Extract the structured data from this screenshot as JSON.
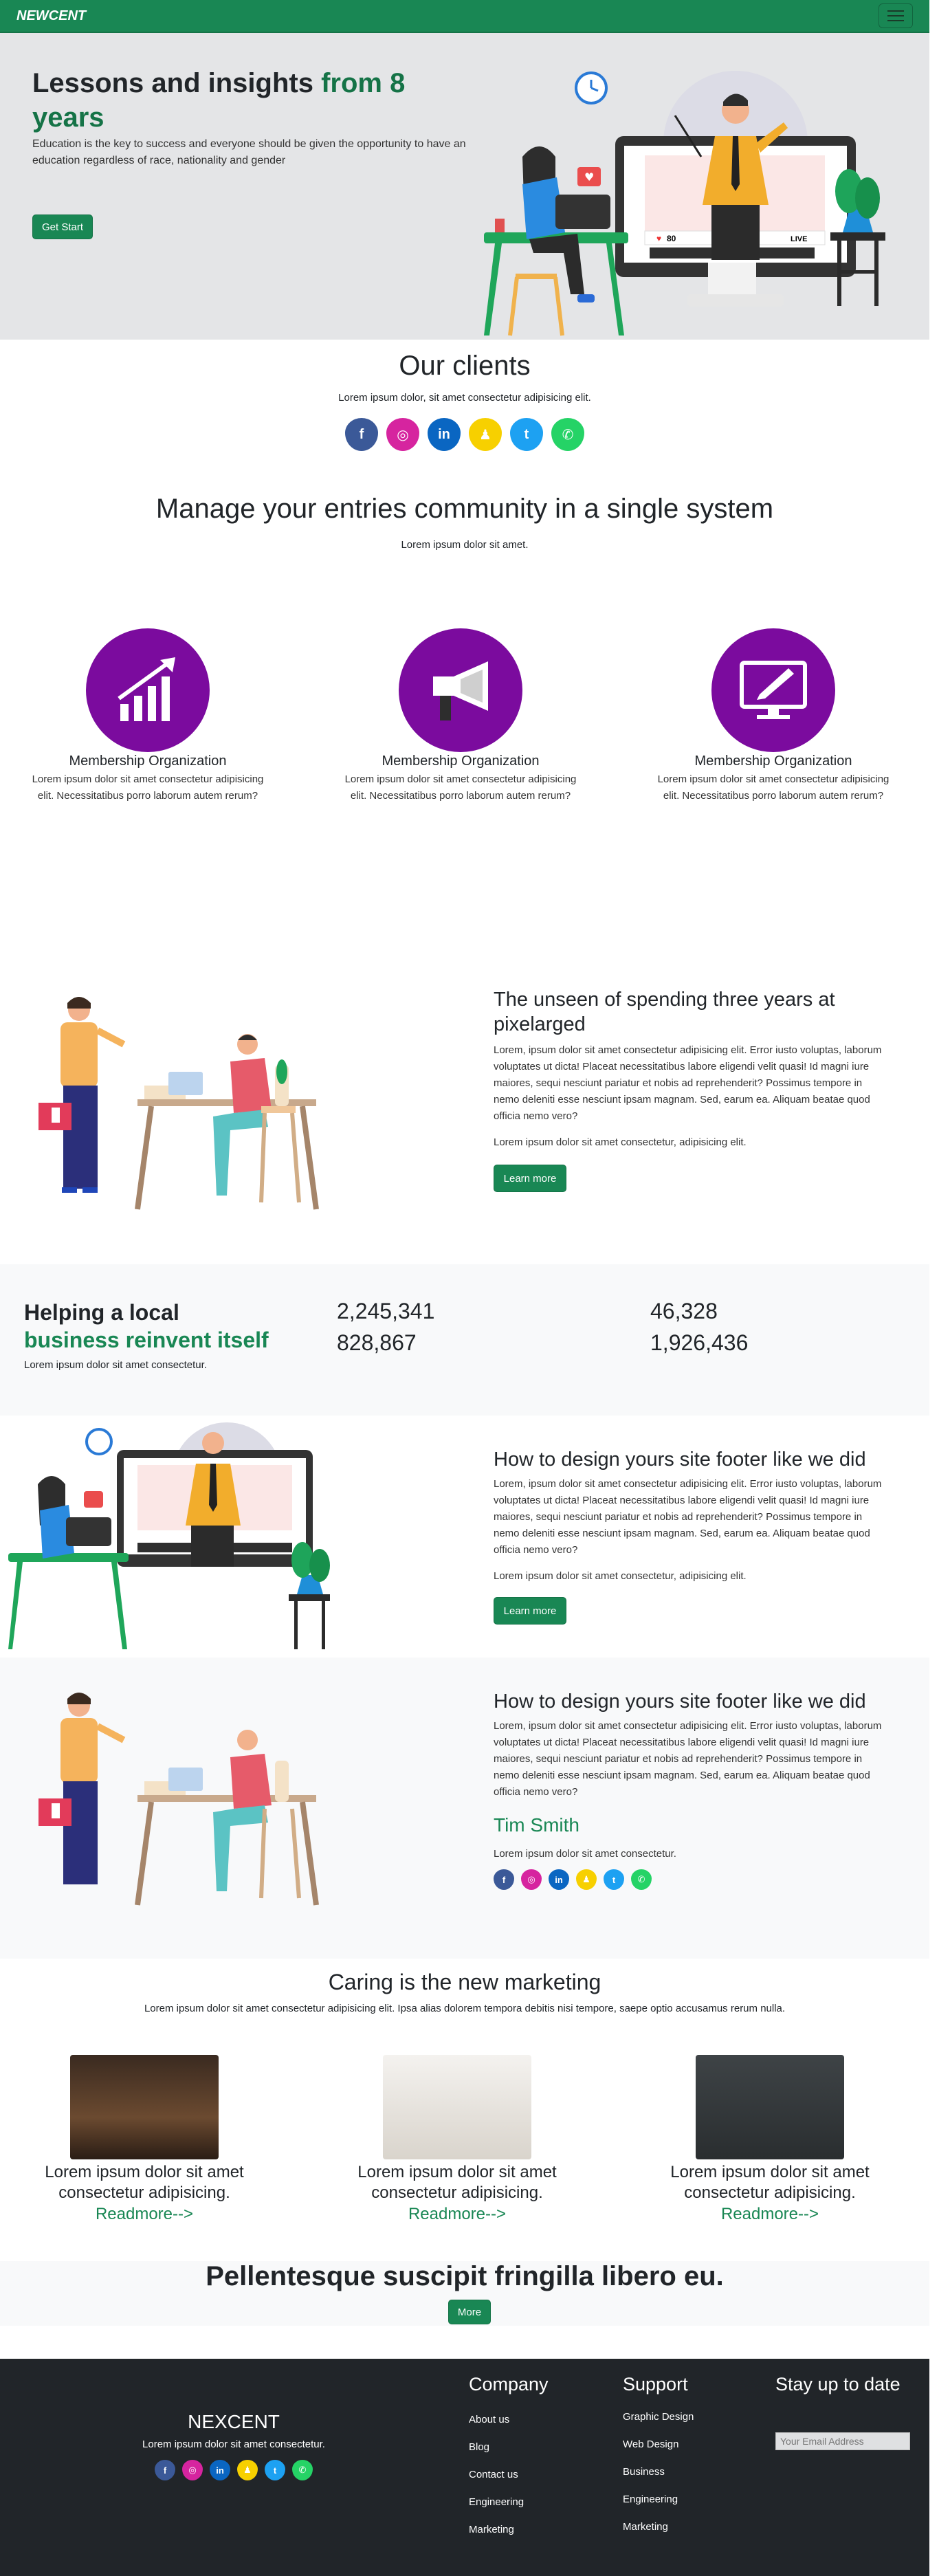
{
  "nav": {
    "brand": "NEWCENT"
  },
  "hero": {
    "title_black": "Lessons and insights ",
    "title_green": "from 8 years",
    "text": "Education is the key to success and everyone should be given the opportunity to have an education regardless of race, nationality and gender",
    "button": "Get Start",
    "screen_likes": "80",
    "screen_live": "LIVE"
  },
  "clients": {
    "title": "Our clients",
    "text": "Lorem ipsum dolor, sit amet consectetur adipisicing elit.",
    "icons": [
      {
        "name": "facebook-icon",
        "glyph": "f",
        "color": "#3b5998"
      },
      {
        "name": "instagram-icon",
        "glyph": "◎",
        "color": "#d6249f"
      },
      {
        "name": "linkedin-icon",
        "glyph": "in",
        "color": "#0a66c2"
      },
      {
        "name": "snapchat-icon",
        "glyph": "♟",
        "color": "#f7d000"
      },
      {
        "name": "twitter-icon",
        "glyph": "t",
        "color": "#1da1f2"
      },
      {
        "name": "whatsapp-icon",
        "glyph": "✆",
        "color": "#25d366"
      }
    ]
  },
  "manage": {
    "title": "Manage your entries community in a single system",
    "text": "Lorem ipsum dolor sit amet.",
    "features": [
      {
        "icon": "growth-chart-icon",
        "title": "Membership Organization",
        "text": "Lorem ipsum dolor sit amet consectetur adipisicing elit. Necessitatibus porro laborum autem rerum?"
      },
      {
        "icon": "megaphone-icon",
        "title": "Membership Organization",
        "text": "Lorem ipsum dolor sit amet consectetur adipisicing elit. Necessitatibus porro laborum autem rerum?"
      },
      {
        "icon": "monitor-pen-icon",
        "title": "Membership Organization",
        "text": "Lorem ipsum dolor sit amet consectetur adipisicing elit. Necessitatibus porro laborum autem rerum?"
      }
    ]
  },
  "unseen": {
    "title": "The unseen of spending three years at pixelarged",
    "text": "Lorem, ipsum dolor sit amet consectetur adipisicing elit. Error iusto voluptas, laborum voluptates ut dicta! Placeat necessitatibus labore eligendi velit quasi! Id magni iure maiores, sequi nesciunt pariatur et nobis ad reprehenderit? Possimus tempore in nemo deleniti esse nesciunt ipsam magnam. Sed, earum ea. Aliquam beatae quod officia nemo vero?",
    "text2": "Lorem ipsum dolor sit amet consectetur, adipisicing elit.",
    "button": "Learn more"
  },
  "stats": {
    "title_black": "Helping a local",
    "title_green": "business reinvent itself",
    "text": "Lorem ipsum dolor sit amet consectetur.",
    "numbers": [
      "2,245,341",
      "46,328",
      "828,867",
      "1,926,436"
    ]
  },
  "footer_design": {
    "title": "How to design yours site footer like we did",
    "text": "Lorem, ipsum dolor sit amet consectetur adipisicing elit. Error iusto voluptas, laborum voluptates ut dicta! Placeat necessitatibus labore eligendi velit quasi! Id magni iure maiores, sequi nesciunt pariatur et nobis ad reprehenderit? Possimus tempore in nemo deleniti esse nesciunt ipsam magnam. Sed, earum ea. Aliquam beatae quod officia nemo vero?",
    "text2": "Lorem ipsum dolor sit amet consectetur, adipisicing elit.",
    "button": "Learn more"
  },
  "testimonial": {
    "title": "How to design yours site footer like we did",
    "text": "Lorem, ipsum dolor sit amet consectetur adipisicing elit. Error iusto voluptas, laborum voluptates ut dicta! Placeat necessitatibus labore eligendi velit quasi! Id magni iure maiores, sequi nesciunt pariatur et nobis ad reprehenderit? Possimus tempore in nemo deleniti esse nesciunt ipsam magnam. Sed, earum ea. Aliquam beatae quod officia nemo vero?",
    "name": "Tim Smith",
    "role": "Lorem ipsum dolor sit amet consectetur."
  },
  "caring": {
    "title": "Caring is the new marketing",
    "text": "Lorem ipsum dolor sit amet consectetur adipisicing elit. Ipsa alias dolorem tempora debitis nisi tempore, saepe optio accusamus rerum nulla.",
    "cards": [
      {
        "photo": "library-photo",
        "title": "Lorem ipsum dolor sit amet consectetur adipisicing.",
        "link": "Readmore-->"
      },
      {
        "photo": "laptop-desk-photo",
        "title": "Lorem ipsum dolor sit amet consectetur adipisicing.",
        "link": "Readmore-->"
      },
      {
        "photo": "chalkboard-photo",
        "title": "Lorem ipsum dolor sit amet consectetur adipisicing.",
        "link": "Readmore-->"
      }
    ]
  },
  "cta": {
    "title": "Pellentesque suscipit fringilla libero eu.",
    "button": "More"
  },
  "footer": {
    "brand": "NEXCENT",
    "text": "Lorem ipsum dolor sit amet consectetur.",
    "company_title": "Company",
    "company_links": [
      "About us",
      "Blog",
      "Contact us",
      "Engineering",
      "Marketing"
    ],
    "support_title": "Support",
    "support_links": [
      "Graphic Design",
      "Web Design",
      "Business",
      "Engineering",
      "Marketing"
    ],
    "newsletter_title": "Stay up to date",
    "email_placeholder": "Your Email Address"
  }
}
